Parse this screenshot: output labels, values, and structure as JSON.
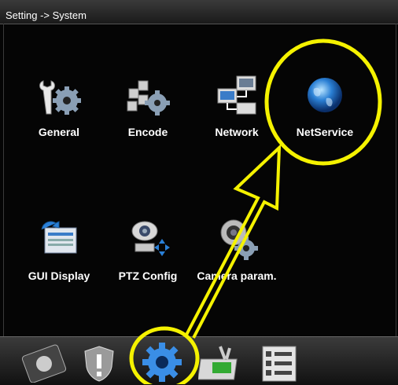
{
  "title": "Setting -> System",
  "tiles": [
    {
      "label": "General",
      "icon": "wrench-gear-icon"
    },
    {
      "label": "Encode",
      "icon": "encode-gear-icon"
    },
    {
      "label": "Network",
      "icon": "network-computers-icon"
    },
    {
      "label": "NetService",
      "icon": "globe-icon"
    },
    {
      "label": "GUI Display",
      "icon": "display-icon"
    },
    {
      "label": "PTZ Config",
      "icon": "ptz-camera-icon"
    },
    {
      "label": "Camera param.",
      "icon": "camera-gear-icon"
    }
  ],
  "bottom_icons": [
    "hard-disk-icon",
    "alarm-shield-icon",
    "system-gear-icon",
    "tools-icon",
    "info-list-icon"
  ],
  "highlight_color": "#f5f200"
}
